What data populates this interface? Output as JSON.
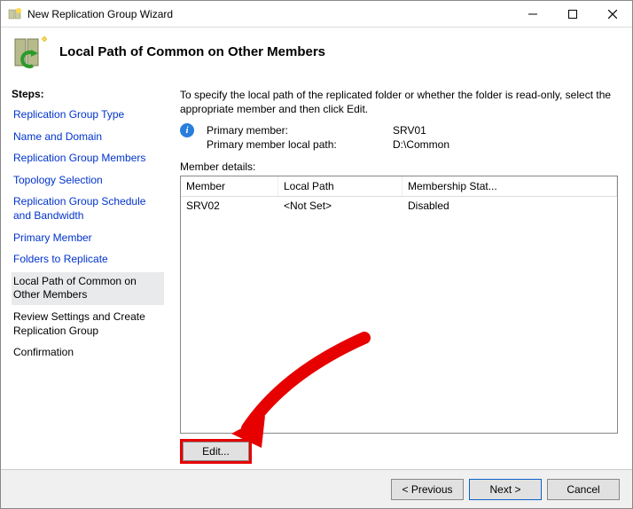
{
  "window": {
    "title": "New Replication Group Wizard"
  },
  "header": {
    "title": "Local Path of Common on Other Members"
  },
  "sidebar": {
    "title": "Steps:",
    "steps": [
      "Replication Group Type",
      "Name and Domain",
      "Replication Group Members",
      "Topology Selection",
      "Replication Group Schedule and Bandwidth",
      "Primary Member",
      "Folders to Replicate",
      "Local Path of Common on Other Members",
      "Review Settings and Create Replication Group",
      "Confirmation"
    ],
    "current_index": 7
  },
  "content": {
    "instruction": "To specify the local path of the replicated folder or whether the folder is read-only, select the appropriate member and then click Edit.",
    "primary_label": "Primary member:",
    "primary_value": "SRV01",
    "primary_path_label": "Primary member local path:",
    "primary_path_value": "D:\\Common",
    "member_details_label": "Member details:",
    "columns": {
      "c1": "Member",
      "c2": "Local Path",
      "c3": "Membership Stat..."
    },
    "rows": [
      {
        "member": "SRV02",
        "path": "<Not Set>",
        "status": "Disabled"
      }
    ],
    "edit_label": "Edit..."
  },
  "footer": {
    "prev": "< Previous",
    "next": "Next >",
    "cancel": "Cancel"
  }
}
